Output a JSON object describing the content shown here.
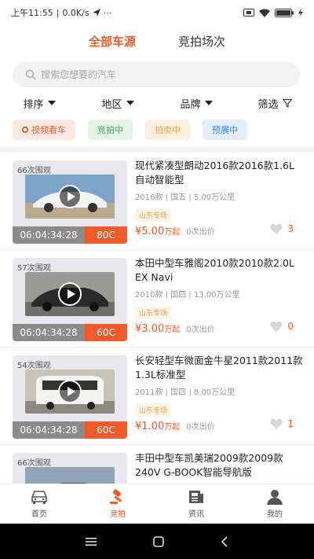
{
  "status_bar": {
    "time": "上午11:55",
    "speed": "0.0K/s",
    "more": "···"
  },
  "tabs": [
    {
      "label": "全部车源",
      "active": true
    },
    {
      "label": "竞拍场次",
      "active": false
    }
  ],
  "search": {
    "placeholder": "搜索您想要的汽车"
  },
  "filters": [
    "排序",
    "地区",
    "品牌",
    "筛选"
  ],
  "chips": [
    "视频看车",
    "竞拍中",
    "拍卖中",
    "预展中"
  ],
  "colors": {
    "accent": "#f05a2a",
    "green": "#3aa655",
    "orange": "#f0a14b",
    "blue": "#3f86e8"
  },
  "listings": [
    {
      "views": "66次围观",
      "title": "现代紧凑型朗动2016款2016款1.6L 自动智能型",
      "meta": "2016款 | 国五 | 5.00万公里",
      "tag": "山东专场",
      "countdown": "06:04:34:28",
      "code": "80C",
      "price_symbol": "¥",
      "price": "5.00",
      "price_unit": "万起",
      "bids": "0次出价",
      "likes": "3"
    },
    {
      "views": "57次围观",
      "title": "本田中型车雅阁2010款2010款2.0L EX Navi",
      "meta": "2010款 | 国四 | 13.00万公里",
      "tag": "山东专场",
      "countdown": "06:04:34:28",
      "code": "60C",
      "price_symbol": "¥",
      "price": "3.00",
      "price_unit": "万起",
      "bids": "0次出价",
      "likes": "0"
    },
    {
      "views": "54次围观",
      "title": "长安轻型车微面金牛星2011款2011款 1.3L标准型",
      "meta": "2011款 | 国四 | 8.00万公里",
      "tag": "山东专场",
      "countdown": "06:04:34:28",
      "code": "60C",
      "price_symbol": "¥",
      "price": "1.00",
      "price_unit": "万起",
      "bids": "0次出价",
      "likes": "1"
    },
    {
      "views": "66次围观",
      "title": "丰田中型车凯美瑞2009款2009款 240V G-BOOK智能导航版",
      "meta": "",
      "tag": "",
      "countdown": "",
      "code": "",
      "price_symbol": "",
      "price": "",
      "price_unit": "",
      "bids": "",
      "likes": ""
    }
  ],
  "bottom_nav": [
    {
      "label": "首页",
      "icon": "car-icon",
      "active": false
    },
    {
      "label": "竞拍",
      "icon": "gavel-icon",
      "active": true
    },
    {
      "label": "资讯",
      "icon": "news-icon",
      "active": false
    },
    {
      "label": "我的",
      "icon": "user-icon",
      "active": false
    }
  ]
}
